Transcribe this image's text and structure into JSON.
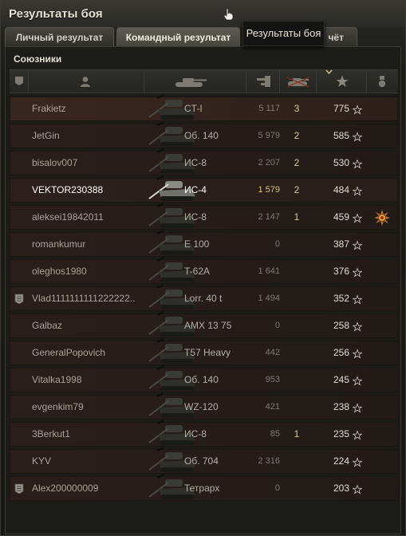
{
  "window": {
    "title": "Результаты боя",
    "tooltip": "Результаты боя"
  },
  "tabs": [
    {
      "label": "Личный результат",
      "active": false
    },
    {
      "label": "Командный результат",
      "active": true
    },
    {
      "label": "чёт",
      "active": false
    }
  ],
  "section": {
    "title": "Союзники"
  },
  "columns": [
    {
      "icon": "platoon-icon"
    },
    {
      "icon": "player-icon"
    },
    {
      "icon": "tank-icon"
    },
    {
      "icon": "damage-icon"
    },
    {
      "icon": "kills-icon"
    },
    {
      "icon": "experience-star-icon",
      "sorted": true
    },
    {
      "icon": "medal-icon"
    }
  ],
  "players": [
    {
      "name": "Frakietz",
      "tank": "CT-I",
      "damage": "5 117",
      "kills": "3",
      "xp": "775"
    },
    {
      "name": "JetGin",
      "tank": "Об. 140",
      "damage": "5 979",
      "kills": "2",
      "xp": "585"
    },
    {
      "name": "bisalov007",
      "tank": "ИС-8",
      "damage": "2 207",
      "kills": "2",
      "xp": "530"
    },
    {
      "name": "VEKTOR230388",
      "tank": "ИС-4",
      "damage": "1 579",
      "kills": "2",
      "xp": "484",
      "is_me": true
    },
    {
      "name": "aleksei19842011",
      "tank": "ИС-8",
      "damage": "2 147",
      "kills": "1",
      "xp": "459",
      "medal": true
    },
    {
      "name": "romankumur",
      "tank": "E 100",
      "damage": "0",
      "kills": "",
      "xp": "387"
    },
    {
      "name": "oleghos1980",
      "tank": "T-62A",
      "damage": "1 641",
      "kills": "",
      "xp": "376"
    },
    {
      "name": "Vlad1111111111222222..",
      "tank": "Lorr. 40 t",
      "damage": "1 494",
      "kills": "",
      "xp": "352",
      "platoon": true
    },
    {
      "name": "Galbaz",
      "tank": "AMX 13 75",
      "damage": "0",
      "kills": "",
      "xp": "258"
    },
    {
      "name": "GeneralPopovich",
      "tank": "T57 Heavy",
      "damage": "442",
      "kills": "",
      "xp": "256"
    },
    {
      "name": "Vitalka1998",
      "tank": "Об. 140",
      "damage": "953",
      "kills": "",
      "xp": "245"
    },
    {
      "name": "evgenkim79",
      "tank": "WZ-120",
      "damage": "421",
      "kills": "",
      "xp": "238"
    },
    {
      "name": "3Berkut1",
      "tank": "ИС-8",
      "damage": "85",
      "kills": "1",
      "xp": "235"
    },
    {
      "name": "KYV",
      "tank": "Об. 704",
      "damage": "2 316",
      "kills": "",
      "xp": "224"
    },
    {
      "name": "Alex200000009",
      "tank": "Тетрарх",
      "damage": "0",
      "kills": "",
      "xp": "203",
      "platoon": true
    }
  ]
}
